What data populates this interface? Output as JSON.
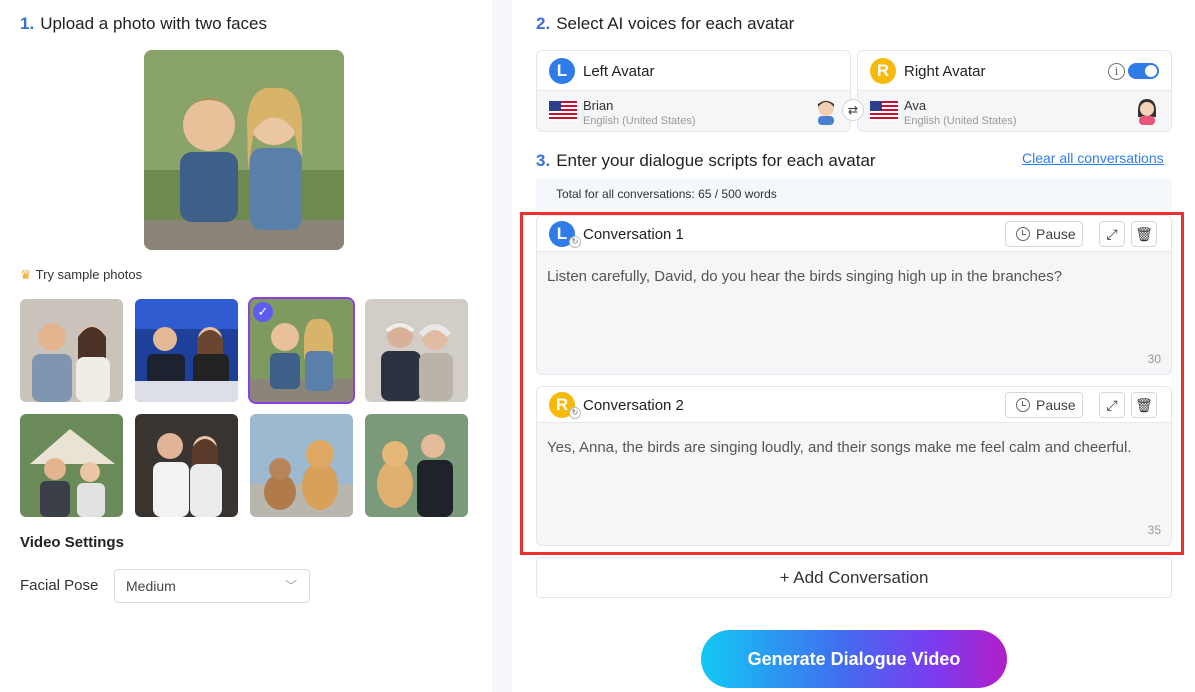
{
  "left": {
    "step1": {
      "num": "1.",
      "title": "Upload a photo with two faces"
    },
    "sample_label": "Try sample photos",
    "video_settings": "Video Settings",
    "facial_pose": {
      "label": "Facial Pose",
      "value": "Medium"
    }
  },
  "right": {
    "step2": {
      "num": "2.",
      "title": "Select AI voices for each avatar"
    },
    "left_avatar": {
      "badge": "L",
      "title": "Left Avatar",
      "voice": "Brian",
      "language": "English (United States)"
    },
    "right_avatar": {
      "badge": "R",
      "title": "Right Avatar",
      "voice": "Ava",
      "language": "English (United States)"
    },
    "step3": {
      "num": "3.",
      "title": "Enter your dialogue scripts for each avatar"
    },
    "clear_all": "Clear all conversations",
    "total": "Total for all conversations: 65 / 500 words",
    "conversations": [
      {
        "badge": "L",
        "title": "Conversation 1",
        "pause": "Pause",
        "text": "Listen carefully, David, do you hear the birds singing high up in the branches?",
        "count": "30"
      },
      {
        "badge": "R",
        "title": "Conversation 2",
        "pause": "Pause",
        "text": "Yes, Anna, the birds are singing loudly, and their songs make me feel calm and cheerful.",
        "count": "35"
      }
    ],
    "add_conversation": "+ Add Conversation",
    "generate": "Generate Dialogue Video"
  },
  "colors": {
    "accent": "#2f7be8",
    "right_badge": "#f7b90a",
    "highlight_box": "#ee2f2f"
  }
}
